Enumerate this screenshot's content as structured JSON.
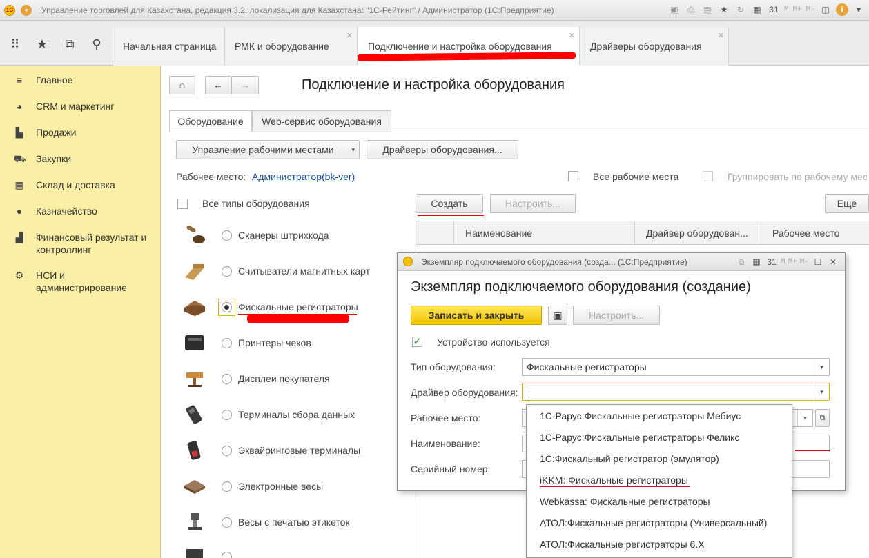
{
  "window": {
    "title": "Управление торговлей для Казахстана, редакция 3.2, локализация для Казахстана: \"1С-Рейтинг\" / Администратор  (1С:Предприятие)",
    "toolbar_mem": [
      "M",
      "M+",
      "M-"
    ]
  },
  "tabs": [
    {
      "label": "Начальная страница"
    },
    {
      "label": "РМК и оборудование"
    },
    {
      "label": "Подключение и настройка оборудования"
    },
    {
      "label": "Драйверы оборудования"
    }
  ],
  "sidebar": {
    "items": [
      {
        "label": "Главное",
        "icon": "menu-icon"
      },
      {
        "label": "CRM и маркетинг",
        "icon": "pie-chart-icon"
      },
      {
        "label": "Продажи",
        "icon": "bag-icon"
      },
      {
        "label": "Закупки",
        "icon": "cart-icon"
      },
      {
        "label": "Склад и доставка",
        "icon": "grid-icon"
      },
      {
        "label": "Казначейство",
        "icon": "coin-icon"
      },
      {
        "label": "Финансовый результат и контроллинг",
        "icon": "bar-chart-icon"
      },
      {
        "label": "НСИ и администрирование",
        "icon": "gear-icon"
      }
    ]
  },
  "page": {
    "title": "Подключение и настройка оборудования",
    "subtabs": [
      "Оборудование",
      "Web-сервис оборудования"
    ],
    "manage_workplaces": "Управление рабочими местами",
    "drivers_button": "Драйверы оборудования...",
    "workplace_label": "Рабочее место:",
    "workplace_value": "Администратор(bk-ver)",
    "all_workplaces": "Все рабочие места",
    "group_by_workplace": "Группировать по рабочему мес",
    "all_types": "Все типы оборудования",
    "create_button": "Создать",
    "configure_button": "Настроить...",
    "more_button": "Еще",
    "equipment_types": [
      {
        "label": "Сканеры штрихкода",
        "selected": false
      },
      {
        "label": "Считыватели магнитных карт",
        "selected": false
      },
      {
        "label": "Фискальные регистраторы",
        "selected": true
      },
      {
        "label": "Принтеры чеков",
        "selected": false
      },
      {
        "label": "Дисплеи покупателя",
        "selected": false
      },
      {
        "label": "Терминалы сбора данных",
        "selected": false
      },
      {
        "label": "Эквайринговые терминалы",
        "selected": false
      },
      {
        "label": "Электронные весы",
        "selected": false
      },
      {
        "label": "Весы с печатью этикеток",
        "selected": false
      }
    ],
    "grid_columns": [
      "Наименование",
      "Драйвер оборудован...",
      "Рабочее место"
    ]
  },
  "dialog": {
    "window_title": "Экземпляр подключаемого оборудования (созда... (1С:Предприятие)",
    "heading": "Экземпляр подключаемого оборудования (создание)",
    "save_close": "Записать и закрыть",
    "configure": "Настроить...",
    "device_used": "Устройство используется",
    "device_used_checked": true,
    "fields": {
      "type_label": "Тип оборудования:",
      "type_value": "Фискальные регистраторы",
      "driver_label": "Драйвер оборудования:",
      "driver_value": "",
      "workplace_label": "Рабочее место:",
      "name_label": "Наименование:",
      "serial_label": "Серийный номер:"
    },
    "driver_options": [
      "1С-Рарус:Фискальные регистраторы Мебиус",
      "1С-Рарус:Фискальные регистраторы Феликс",
      "1С:Фискальный регистратор (эмулятор)",
      "iKKM: Фискальные регистраторы",
      "Webkassa: Фискальные регистраторы",
      "АТОЛ:Фискальные регистраторы (Универсальный)",
      "АТОЛ:Фискальные регистраторы 6.Х"
    ]
  },
  "colors": {
    "sidebar_bg": "#fbeea5",
    "primary_button": "#f2c500",
    "annotation_red": "#ff0000",
    "link": "#1a4da2"
  }
}
